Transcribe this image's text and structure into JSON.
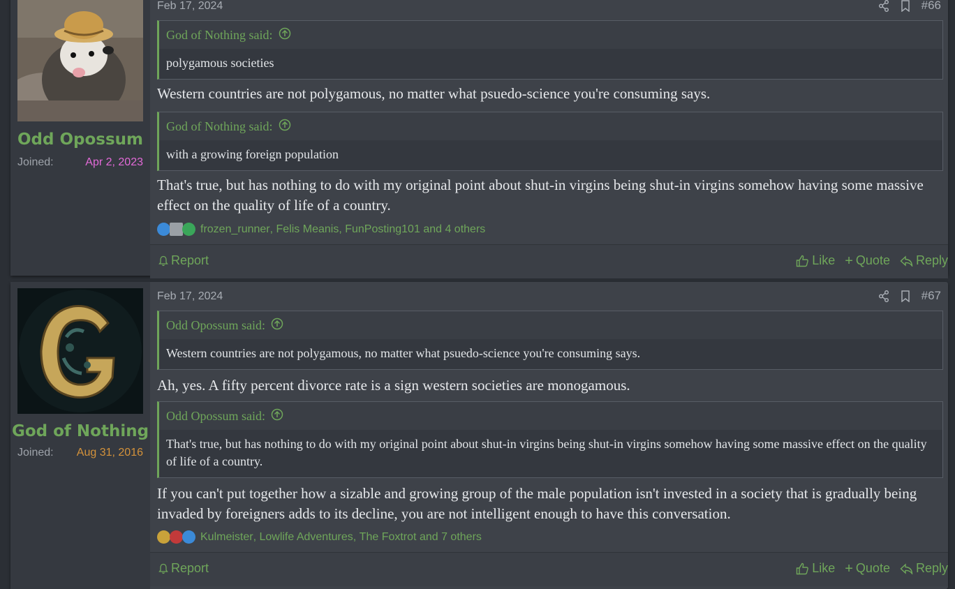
{
  "posts": [
    {
      "username": "Odd Opossum",
      "joined_label": "Joined:",
      "joined_date": "Apr 2, 2023",
      "joined_color": "#e36ad8",
      "date": "Feb 17, 2024",
      "number": "#66",
      "quotes": [
        {
          "author": "God of Nothing said:",
          "text": "polygamous societies"
        },
        {
          "author": "God of Nothing said:",
          "text": "with a growing foreign population"
        }
      ],
      "paragraphs": [
        "Western countries are not polygamous, no matter what psuedo-science you're consuming says.",
        "That's true, but has nothing to do with my original point about shut-in virgins being shut-in virgins somehow having some massive effect on the quality of life of a country."
      ],
      "reactions": {
        "users": [
          "frozen_runner",
          "Felis Meanis",
          "FunPosting101"
        ],
        "others": "and 4 others"
      }
    },
    {
      "username": "God of Nothing",
      "joined_label": "Joined:",
      "joined_date": "Aug 31, 2016",
      "joined_color": "#d4923a",
      "date": "Feb 17, 2024",
      "number": "#67",
      "quotes": [
        {
          "author": "Odd Opossum said:",
          "text": "Western countries are not polygamous, no matter what psuedo-science you're consuming says."
        },
        {
          "author": "Odd Opossum said:",
          "text": "That's true, but has nothing to do with my original point about shut-in virgins being shut-in virgins somehow having some massive effect on the quality of life of a country."
        }
      ],
      "paragraphs": [
        "Ah, yes. A fifty percent divorce rate is a sign western societies are monogamous.",
        "If you can't put together how a sizable and growing group of the male population isn't invested in a society that is gradually being invaded by foreigners adds to its decline, you are not intelligent enough to have this conversation."
      ],
      "reactions": {
        "users": [
          "Kulmeister",
          "Lowlife Adventures",
          "The Foxtrot"
        ],
        "others": "and 7 others"
      }
    }
  ],
  "actions": {
    "report": "Report",
    "like": "Like",
    "quote": "Quote",
    "reply": "Reply"
  },
  "colors": {
    "accent": "#6fa65a",
    "background": "#2b2f35",
    "post_bg": "#3e4249"
  }
}
